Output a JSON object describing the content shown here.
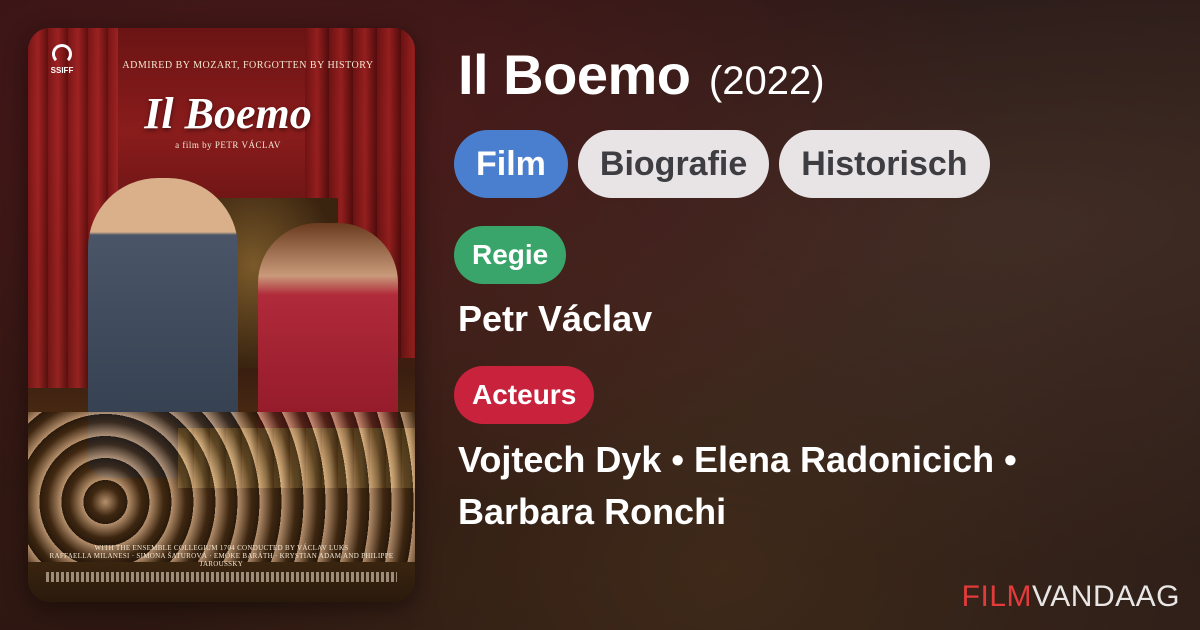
{
  "poster": {
    "tagline": "ADMIRED BY MOZART, FORGOTTEN BY HISTORY",
    "title": "Il Boemo",
    "director_credit": "a film by PETR VÁCLAV",
    "festival_logo": "SSIFF",
    "credits_line": "WITH THE ENSEMBLE COLLEGIUM 1704 CONDUCTED BY VÁCLAV LUKS",
    "cast_line": "RAFFAELLA MILANESI · SIMONA ŠATUROVÁ · EMŐKE BARÁTH · KRYSTIAN ADAM AND PHILIPPE JAROUSSKY"
  },
  "movie": {
    "title": "Il Boemo",
    "year": "(2022)"
  },
  "genres": {
    "type": "Film",
    "items": [
      "Biografie",
      "Historisch"
    ]
  },
  "director": {
    "label": "Regie",
    "name": "Petr Václav"
  },
  "cast": {
    "label": "Acteurs",
    "line1": "Vojtech Dyk • Elena Radonicich •",
    "line2": "Barbara Ronchi"
  },
  "brand": {
    "part1": "FILM",
    "part2": "VANDAAG"
  },
  "colors": {
    "film_pill": "#4a7fd0",
    "genre_pill": "#e8e4e6",
    "regie_pill": "#3aa56a",
    "acteurs_pill": "#c8223c",
    "brand_red": "#e23b3b"
  }
}
